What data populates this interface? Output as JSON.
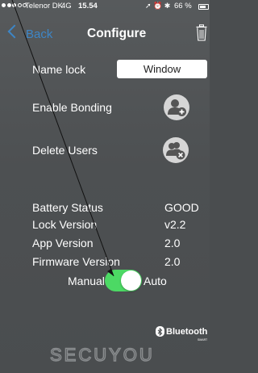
{
  "status_bar": {
    "carrier": "Telenor DK",
    "network": "4G",
    "time": "15.54",
    "battery": "66 %",
    "battery_level": 0.66
  },
  "nav": {
    "back_label": "Back",
    "title": "Configure"
  },
  "settings": {
    "name_lock_label": "Name lock",
    "name_lock_value": "Window",
    "enable_bonding_label": "Enable Bonding",
    "delete_users_label": "Delete Users"
  },
  "info": {
    "battery_status_label": "Battery Status",
    "battery_status_value": "GOOD",
    "lock_version_label": "Lock Version",
    "lock_version_value": "v2.2",
    "app_version_label": "App Version",
    "app_version_value": "2.0",
    "firmware_version_label": "Firmware Version",
    "firmware_version_value": "2.0"
  },
  "mode_toggle": {
    "left_label": "Manual",
    "right_label": "Auto",
    "on": true
  },
  "branding": {
    "bluetooth_text": "Bluetooth",
    "bluetooth_sub": "SMART",
    "product_logo": "SECUYOU"
  },
  "colors": {
    "accent": "#3d86c7",
    "toggle_on": "#4cd964",
    "background": "#4d5052"
  },
  "icons": [
    "back-chevron-icon",
    "trash-icon",
    "add-user-icon",
    "delete-users-icon",
    "bluetooth-icon"
  ]
}
